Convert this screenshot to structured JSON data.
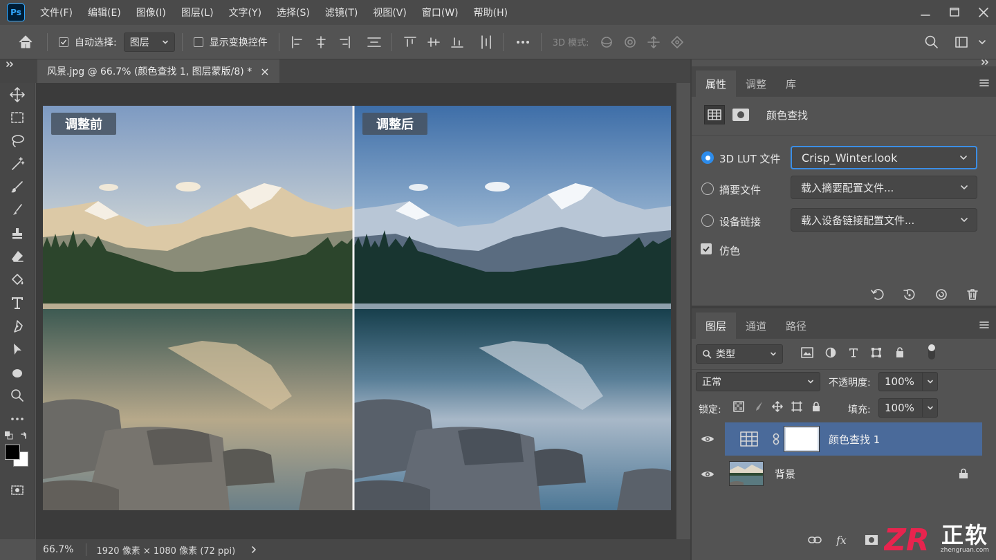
{
  "app": {
    "logo": "Ps"
  },
  "menu": [
    "文件(F)",
    "编辑(E)",
    "图像(I)",
    "图层(L)",
    "文字(Y)",
    "选择(S)",
    "滤镜(T)",
    "视图(V)",
    "窗口(W)",
    "帮助(H)"
  ],
  "options_bar": {
    "auto_select_label": "自动选择:",
    "auto_select_target": "图层",
    "show_transform_label": "显示变换控件",
    "mode_3d_label": "3D 模式:"
  },
  "document_tab": {
    "title": "风景.jpg @ 66.7% (颜色查找 1, 图层蒙版/8) *",
    "close": "×"
  },
  "canvas": {
    "label_before": "调整前",
    "label_after": "调整后"
  },
  "status": {
    "zoom": "66.7%",
    "info": "1920 像素 × 1080 像素 (72 ppi)"
  },
  "properties_panel": {
    "tabs": [
      "属性",
      "调整",
      "库"
    ],
    "title": "颜色查找",
    "options": [
      {
        "label": "3D LUT 文件",
        "value": "Crisp_Winter.look",
        "selected": true
      },
      {
        "label": "摘要文件",
        "value": "载入摘要配置文件...",
        "selected": false
      },
      {
        "label": "设备链接",
        "value": "载入设备链接配置文件...",
        "selected": false
      }
    ],
    "dither_label": "仿色",
    "dither_checked": true
  },
  "layers_panel": {
    "tabs": [
      "图层",
      "通道",
      "路径"
    ],
    "filter_label": "类型",
    "blend_mode": "正常",
    "opacity_label": "不透明度:",
    "opacity": "100%",
    "lock_label": "锁定:",
    "fill_label": "填充:",
    "fill": "100%",
    "layers": [
      {
        "name": "颜色查找 1",
        "visible": true,
        "selected": true
      },
      {
        "name": "背景",
        "visible": true,
        "locked": true
      }
    ]
  },
  "watermark": {
    "zr": "ZR",
    "text": "正软",
    "url": "zhengruan.com"
  },
  "colors": {
    "accent": "#2d8ceb",
    "selected_layer": "#4a6a9a",
    "panel_bg": "#535353"
  }
}
